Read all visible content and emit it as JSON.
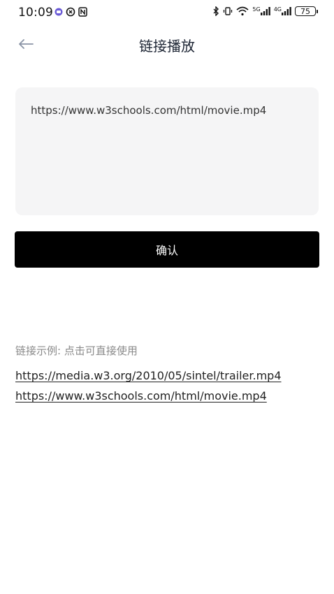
{
  "status_bar": {
    "time": "10:09",
    "network_5g": "5G",
    "network_4g": "4G",
    "battery": "75"
  },
  "header": {
    "title": "链接播放",
    "back_icon": "arrow-left-icon"
  },
  "url_input": {
    "value": "https://www.w3schools.com/html/movie.mp4"
  },
  "confirm_button": {
    "label": "确认"
  },
  "examples": {
    "heading": "链接示例: 点击可直接使用",
    "links": [
      "https://media.w3.org/2010/05/sintel/trailer.mp4",
      "https://www.w3schools.com/html/movie.mp4"
    ]
  },
  "colors": {
    "background": "#ffffff",
    "input_bg": "#f5f5f6",
    "button_bg": "#000000",
    "button_text": "#ffffff",
    "title_text": "#1c2433",
    "muted_text": "#8a8a8a",
    "back_arrow": "#8a94a6"
  }
}
